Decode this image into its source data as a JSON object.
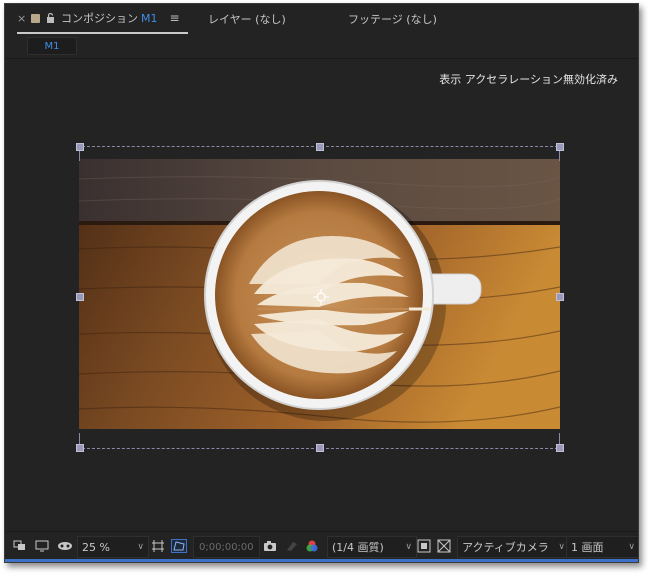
{
  "tabs": {
    "composition": {
      "label": "コンポジション",
      "comp_name": "M1"
    },
    "layer": {
      "label": "レイヤー (なし)"
    },
    "footage": {
      "label": "フッテージ (なし)"
    }
  },
  "subtabs": [
    {
      "label": "M1"
    }
  ],
  "viewer": {
    "status_text": "表示 アクセラレーション無効化済み"
  },
  "toolbar": {
    "zoom": "25 %",
    "timecode": "0;00;00;00",
    "resolution": "(1/4 画質)",
    "camera": "アクティブカメラ",
    "views": "1 画面"
  },
  "icons": {
    "close": "close-icon",
    "lock": "lock-icon",
    "menu": "hamburger-menu-icon"
  },
  "colors": {
    "accent_blue": "#3d8ee6",
    "panel_bg": "#232323",
    "handle": "#9a9ab8"
  }
}
